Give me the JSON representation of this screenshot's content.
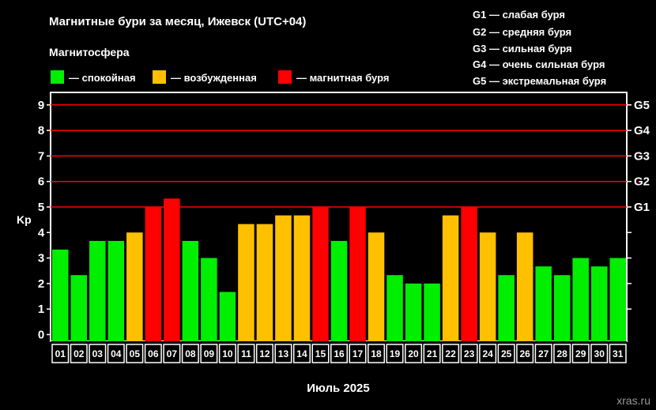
{
  "title": "Магнитные бури за месяц, Ижевск (UTC+04)",
  "legend_title": "Магнитосфера",
  "legend": [
    {
      "label": "— спокойная",
      "color": "#00ee00"
    },
    {
      "label": "— возбужденная",
      "color": "#ffc000"
    },
    {
      "label": "— магнитная буря",
      "color": "#ff0000"
    }
  ],
  "g_scale": [
    "G1 — слабая буря",
    "G2 — средняя буря",
    "G3 — сильная буря",
    "G4 — очень сильная буря",
    "G5 — экстремальная буря"
  ],
  "watermark": "xras.ru",
  "colors": {
    "calm": "#00ee00",
    "excited": "#ffc000",
    "storm": "#ff0000",
    "grid": "#ff0000",
    "axis": "#ffffff"
  },
  "chart_data": {
    "type": "bar",
    "xlabel": "Июль 2025",
    "ylabel": "Kp",
    "ylim": [
      0,
      9
    ],
    "y_ticks": [
      "0",
      "1",
      "2",
      "3",
      "4",
      "5",
      "6",
      "7",
      "8",
      "9"
    ],
    "right_ticks": [
      {
        "label": "G1",
        "value": 5
      },
      {
        "label": "G2",
        "value": 6
      },
      {
        "label": "G3",
        "value": 7
      },
      {
        "label": "G4",
        "value": 8
      },
      {
        "label": "G5",
        "value": 9
      }
    ],
    "grid": true,
    "categories": [
      "01",
      "02",
      "03",
      "04",
      "05",
      "06",
      "07",
      "08",
      "09",
      "10",
      "11",
      "12",
      "13",
      "14",
      "15",
      "16",
      "17",
      "18",
      "19",
      "20",
      "21",
      "22",
      "23",
      "24",
      "25",
      "26",
      "27",
      "28",
      "29",
      "30",
      "31"
    ],
    "values": [
      3.33,
      2.33,
      3.67,
      3.67,
      4.0,
      5.0,
      5.33,
      3.67,
      3.0,
      1.67,
      4.33,
      4.33,
      4.67,
      4.67,
      5.0,
      3.67,
      5.0,
      4.0,
      2.33,
      2.0,
      2.0,
      4.67,
      5.0,
      4.0,
      2.33,
      4.0,
      2.67,
      2.33,
      3.0,
      2.67,
      3.0
    ],
    "levels": [
      "calm",
      "calm",
      "calm",
      "calm",
      "excited",
      "storm",
      "storm",
      "calm",
      "calm",
      "calm",
      "excited",
      "excited",
      "excited",
      "excited",
      "storm",
      "calm",
      "storm",
      "excited",
      "calm",
      "calm",
      "calm",
      "excited",
      "storm",
      "excited",
      "calm",
      "excited",
      "calm",
      "calm",
      "calm",
      "calm",
      "calm"
    ]
  }
}
